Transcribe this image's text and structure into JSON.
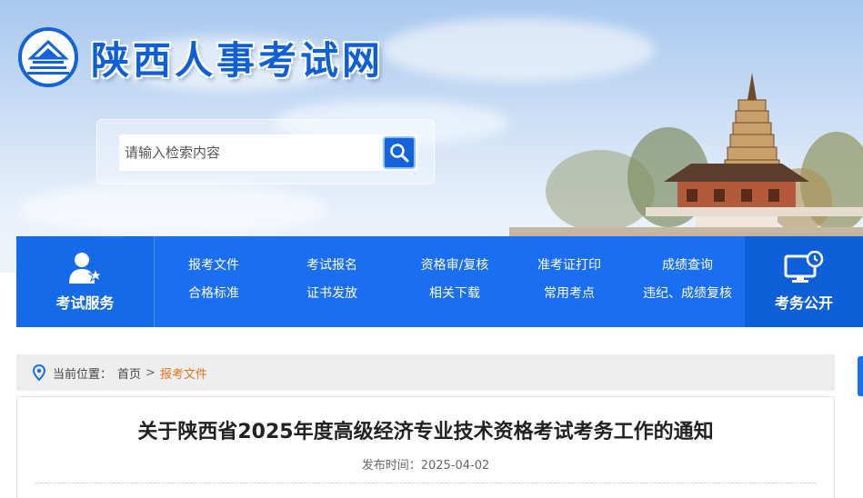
{
  "header": {
    "site_title": "陕西人事考试网",
    "logo_icon": "building-emblem-icon"
  },
  "search": {
    "placeholder": "请输入检索内容",
    "button_icon": "search-icon"
  },
  "nav": {
    "left": {
      "label": "考试服务",
      "icon": "user-star-icon"
    },
    "right": {
      "label": "考务公开",
      "icon": "monitor-clock-icon"
    },
    "columns": [
      {
        "top": "报考文件",
        "bottom": "合格标准"
      },
      {
        "top": "考试报名",
        "bottom": "证书发放"
      },
      {
        "top": "资格审/复核",
        "bottom": "相关下载"
      },
      {
        "top": "准考证打印",
        "bottom": "常用考点"
      },
      {
        "top": "成绩查询",
        "bottom": "违纪、成绩复核"
      }
    ]
  },
  "breadcrumb": {
    "prefix": "当前位置：",
    "home": "首页",
    "separator": ">",
    "current": "报考文件"
  },
  "article": {
    "title": "关于陕西省2025年度高级经济专业技术资格考试考务工作的通知",
    "date_label": "发布时间：",
    "date": "2025-04-02"
  },
  "colors": {
    "brand_blue": "#1a6ef0",
    "accent_orange": "#e8731d"
  }
}
